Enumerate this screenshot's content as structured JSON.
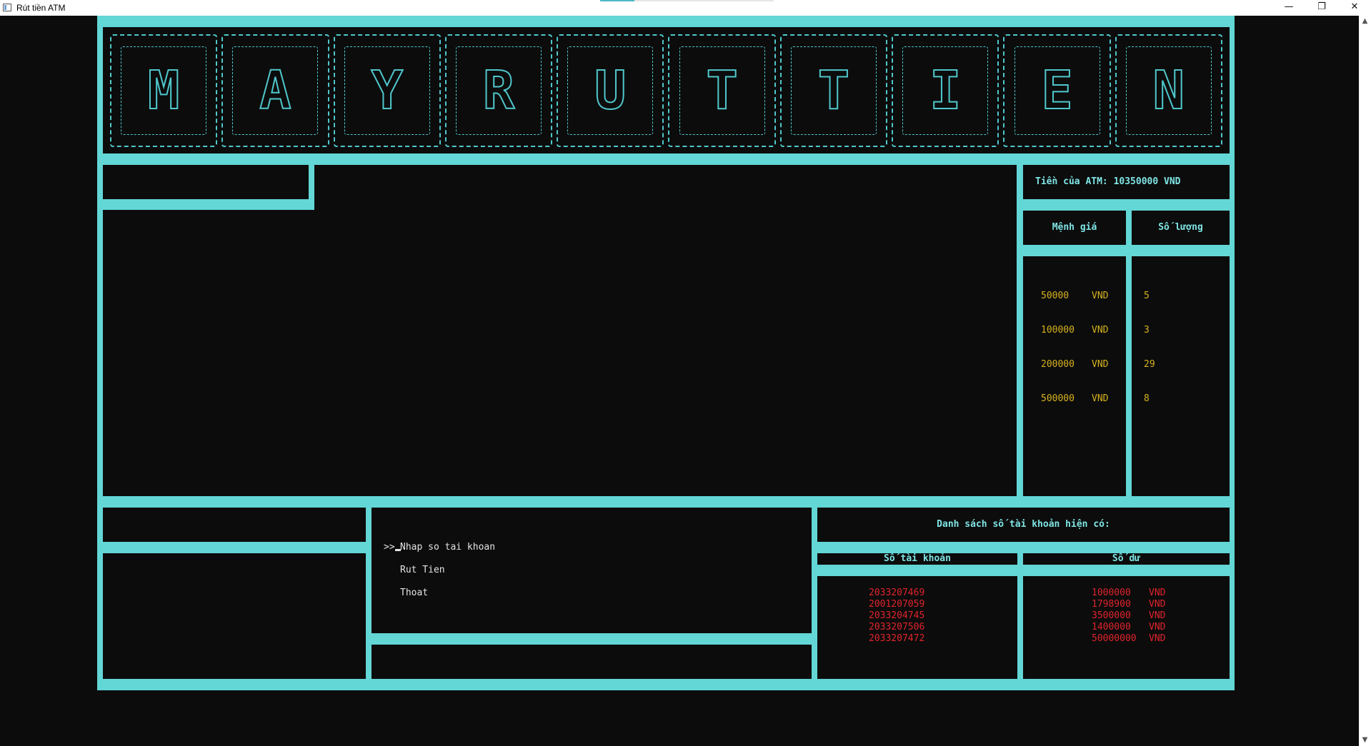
{
  "window": {
    "title": "Rút tiền ATM",
    "minimize_glyph": "—",
    "restore_glyph": "❐",
    "close_glyph": "✕"
  },
  "banner": {
    "letters": [
      "M",
      "A",
      "Y",
      "R",
      "U",
      "T",
      "T",
      "I",
      "E",
      "N"
    ]
  },
  "atm": {
    "total_label": "Tiền của ATM: 10350000 VND",
    "denomination_header": "Mệnh giá",
    "quantity_header": "Số lượng",
    "denominations": [
      {
        "value": "50000",
        "currency": "VND",
        "quantity": "5"
      },
      {
        "value": "100000",
        "currency": "VND",
        "quantity": "3"
      },
      {
        "value": "200000",
        "currency": "VND",
        "quantity": "29"
      },
      {
        "value": "500000",
        "currency": "VND",
        "quantity": "8"
      }
    ]
  },
  "menu": {
    "pointer": ">>",
    "items": [
      "Nhap so tai khoan",
      "Rut Tien",
      "Thoat"
    ]
  },
  "accounts": {
    "title": "Danh sách số tài khoản hiện có:",
    "account_header": "Số tài khoản",
    "balance_header": "Số dư",
    "rows": [
      {
        "account": "2033207469",
        "balance": "1000000",
        "currency": "VND"
      },
      {
        "account": "2001207059",
        "balance": "1798900",
        "currency": "VND"
      },
      {
        "account": "2033204745",
        "balance": "3500000",
        "currency": "VND"
      },
      {
        "account": "2033207506",
        "balance": "1400000",
        "currency": "VND"
      },
      {
        "account": "2033207472",
        "balance": "50000000",
        "currency": "VND"
      }
    ]
  },
  "colors": {
    "frame": "#63d6d6",
    "background": "#0c0c0c",
    "header_text": "#7fe4e4",
    "denomination_text": "#d7b21f",
    "account_text": "#e0242c"
  }
}
